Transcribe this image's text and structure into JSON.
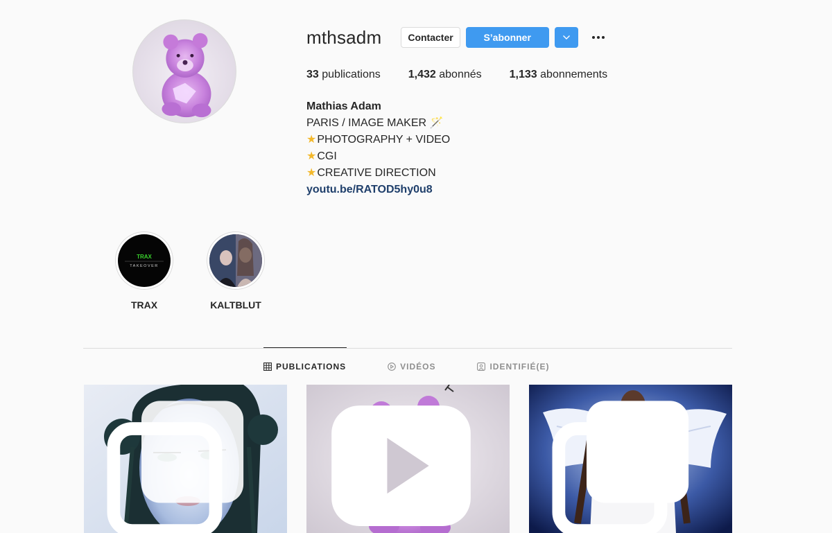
{
  "profile": {
    "username": "mthsadm",
    "contact_label": "Contacter",
    "follow_label": "S’abonner",
    "stats": [
      {
        "value": "33",
        "label": "publications"
      },
      {
        "value": "1,432",
        "label": "abonnés"
      },
      {
        "value": "1,133",
        "label": "abonnements"
      }
    ],
    "bio": {
      "name": "Mathias Adam",
      "line1": "PARIS / IMAGE MAKER 🪄",
      "line2": "PHOTOGRAPHY + VIDEO",
      "line3": "CGI",
      "line4": "CREATIVE DIRECTION",
      "link": "youtu.be/RATOD5hy0u8"
    }
  },
  "highlights": [
    {
      "label": "TRAX",
      "icon": "trax-takeover-cover",
      "cover_title": "TRAX",
      "cover_sub": "TAKEOVER"
    },
    {
      "label": "KALTBLUT",
      "icon": "kaltblut-cover"
    }
  ],
  "tabs": [
    {
      "label": "PUBLICATIONS",
      "icon": "grid-icon",
      "active": true
    },
    {
      "label": "VIDÉOS",
      "icon": "play-circle-icon",
      "active": false
    },
    {
      "label": "IDENTIFIÉ(E)",
      "icon": "tagged-icon",
      "active": false
    }
  ],
  "posts": [
    {
      "kind": "carousel",
      "icon": "carousel-icon"
    },
    {
      "kind": "video",
      "icon": "video-icon"
    },
    {
      "kind": "carousel",
      "icon": "carousel-icon"
    }
  ],
  "colors": {
    "accent": "#3f9af0",
    "link": "#1f3f6b",
    "muted": "#8e8e8e",
    "border": "#dbdbdb"
  }
}
